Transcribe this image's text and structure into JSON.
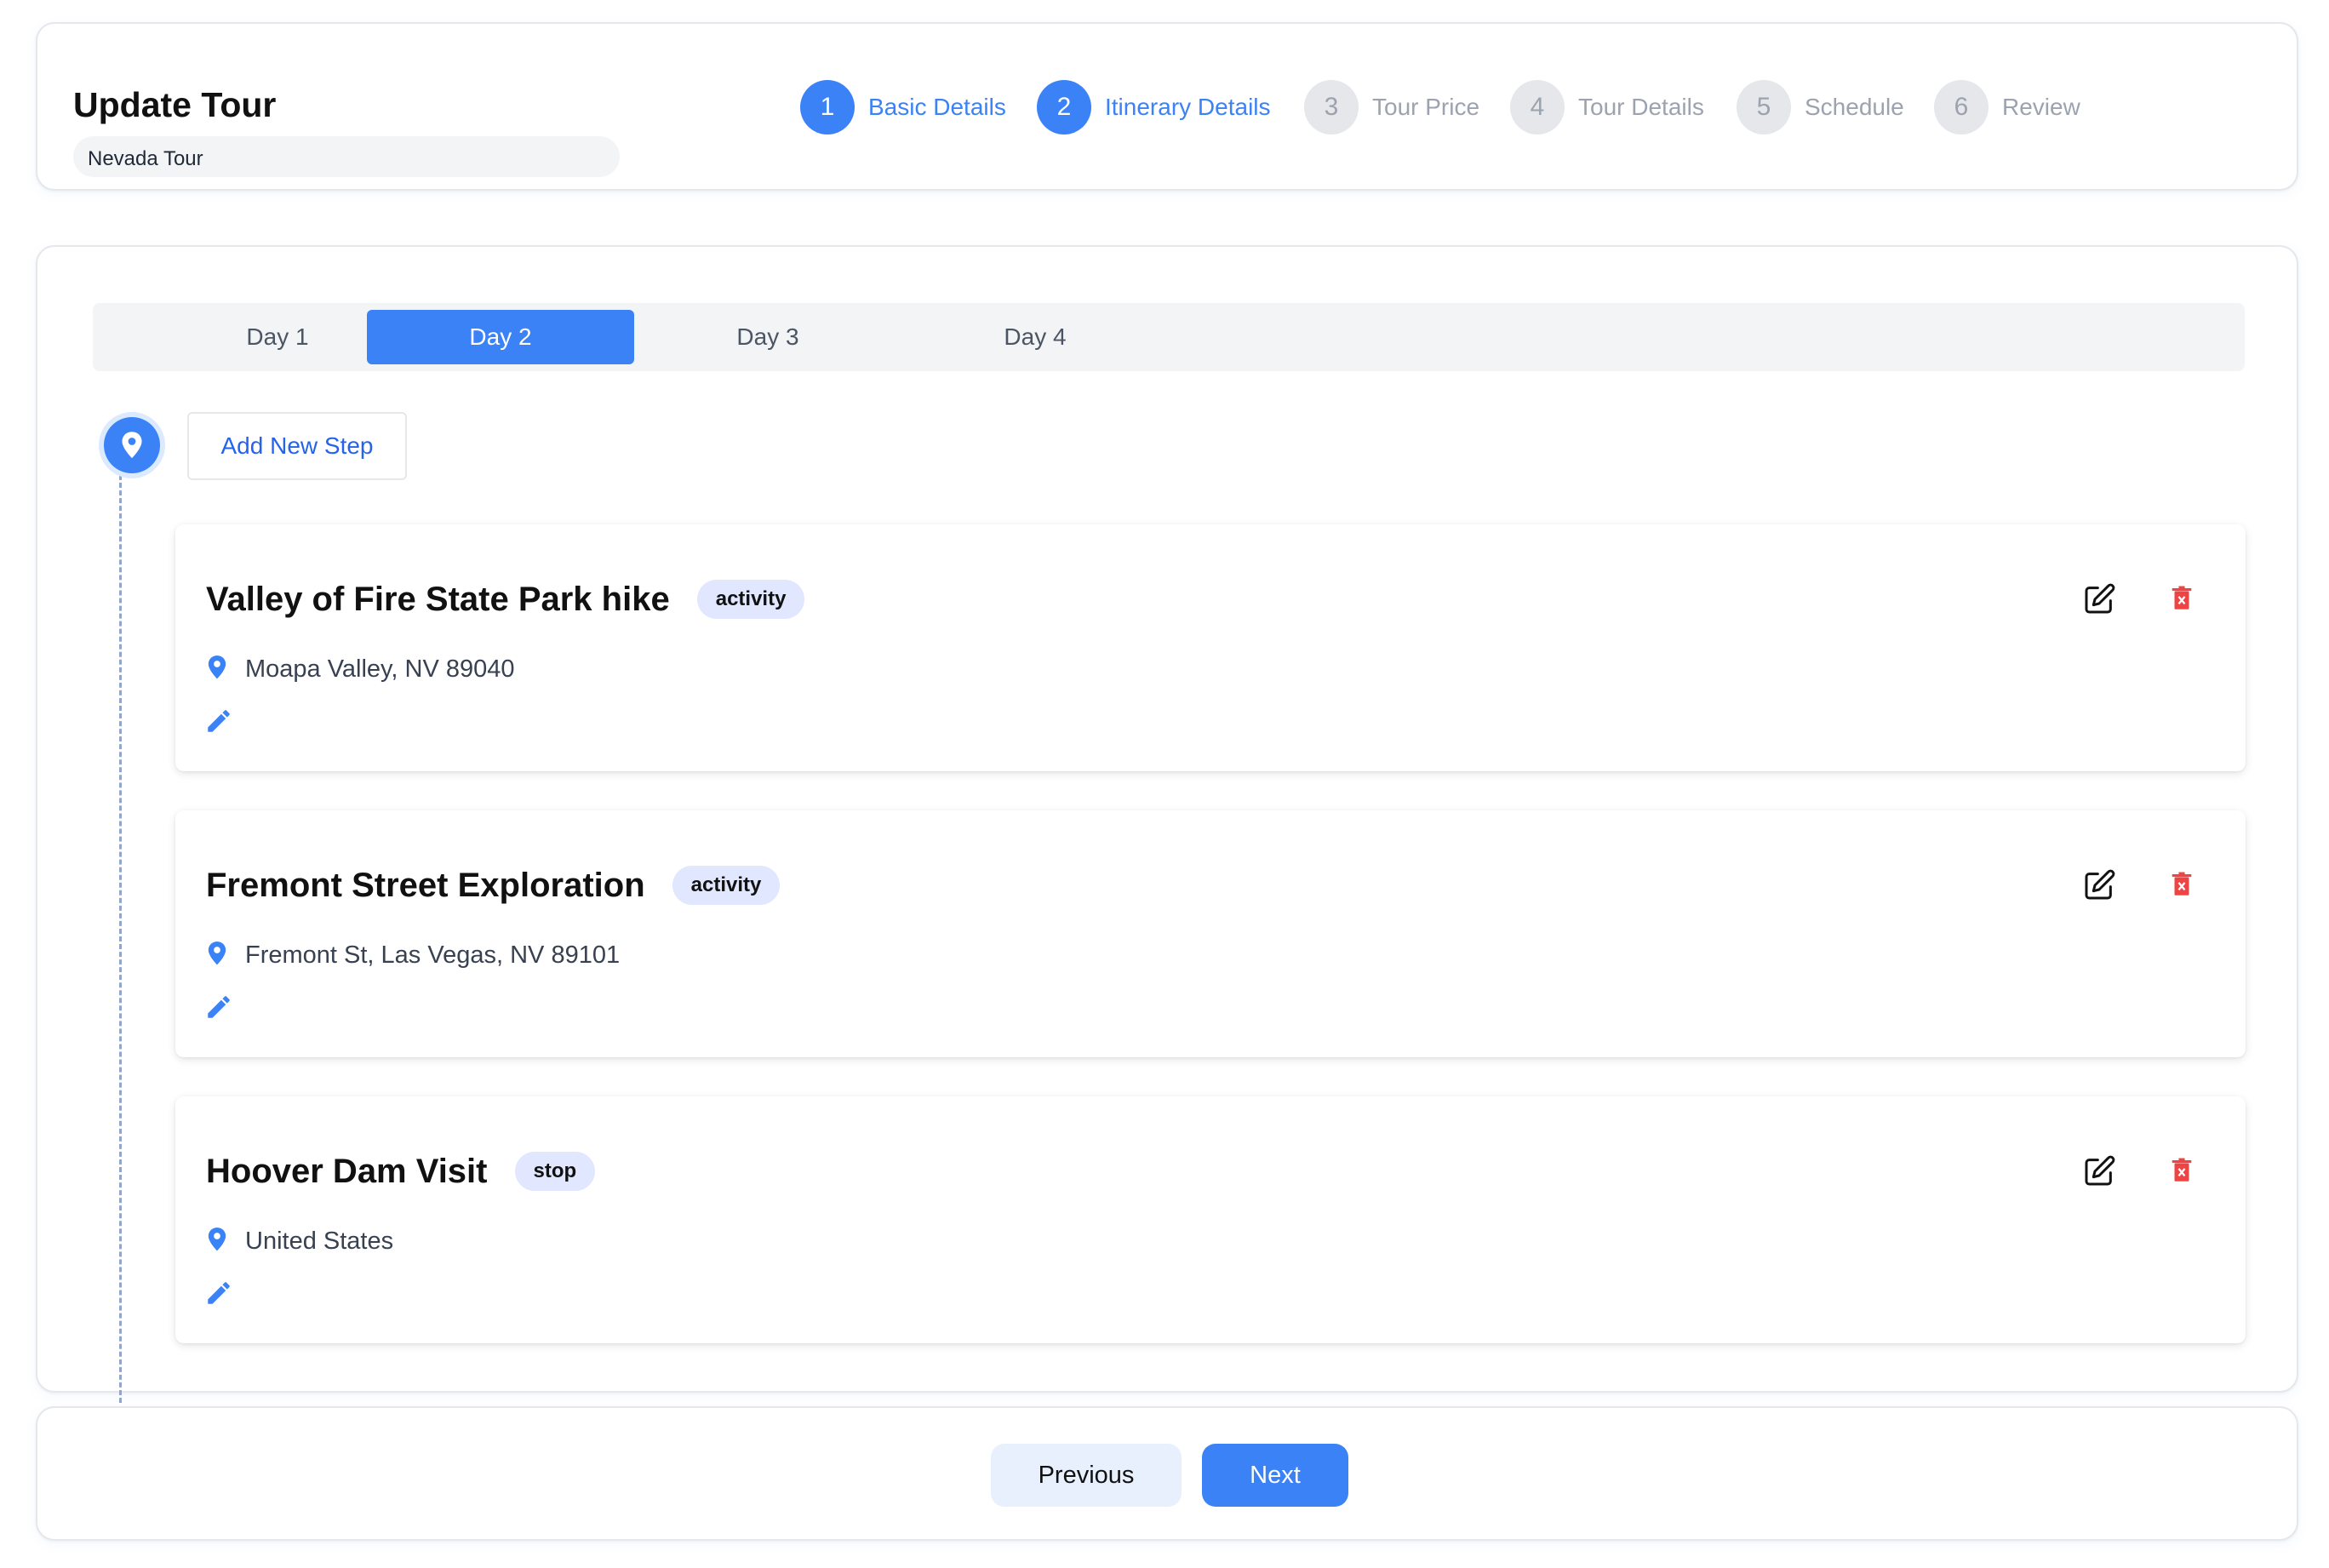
{
  "header": {
    "title": "Update Tour",
    "tour_name": "Nevada Tour",
    "steps": [
      {
        "number": "1",
        "label": "Basic Details",
        "state": "active"
      },
      {
        "number": "2",
        "label": "Itinerary Details",
        "state": "active"
      },
      {
        "number": "3",
        "label": "Tour Price",
        "state": "inactive"
      },
      {
        "number": "4",
        "label": "Tour Details",
        "state": "inactive"
      },
      {
        "number": "5",
        "label": "Schedule",
        "state": "inactive"
      },
      {
        "number": "6",
        "label": "Review",
        "state": "inactive"
      }
    ]
  },
  "tabs": [
    {
      "label": "Day 1",
      "selected": false
    },
    {
      "label": "Day 2",
      "selected": true
    },
    {
      "label": "Day 3",
      "selected": false
    },
    {
      "label": "Day 4",
      "selected": false
    }
  ],
  "add_step_label": "Add New Step",
  "itinerary": [
    {
      "title": "Valley of Fire State Park hike",
      "type": "activity",
      "location": "Moapa Valley, NV 89040"
    },
    {
      "title": "Fremont Street Exploration",
      "type": "activity",
      "location": "Fremont St, Las Vegas, NV 89101"
    },
    {
      "title": "Hoover Dam Visit",
      "type": "stop",
      "location": "United States"
    }
  ],
  "footer": {
    "previous_label": "Previous",
    "next_label": "Next"
  },
  "colors": {
    "accent": "#3b82f6",
    "inactive": "#e5e7eb",
    "danger": "#ef4444",
    "badge_bg": "#e0e7ff"
  },
  "icons": {
    "timeline": "map-pin-icon",
    "location": "map-pin-icon",
    "note": "pencil-icon",
    "edit": "edit-square-icon",
    "delete": "trash-icon"
  }
}
